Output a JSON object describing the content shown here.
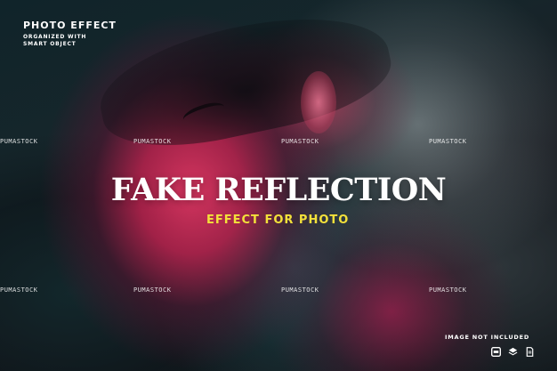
{
  "brand": {
    "title": "PHOTO EFFECT",
    "subtitle_line1": "ORGANIZED WITH",
    "subtitle_line2": "SMART OBJECT"
  },
  "watermarks": [
    "PUMASTOCK",
    "PUMASTOCK",
    "PUMASTOCK",
    "PUMASTOCK",
    "PUMASTOCK",
    "PUMASTOCK",
    "PUMASTOCK",
    "PUMASTOCK"
  ],
  "headline": {
    "main": "FAKE REFLECTION",
    "sub": "EFFECT FOR PHOTO"
  },
  "footer": {
    "note": "IMAGE NOT INCLUDED",
    "icons": [
      "photoshop-icon",
      "layers-icon",
      "document-icon"
    ]
  },
  "colors": {
    "headline": "#ffffff",
    "subheadline": "#f3e13a",
    "accent_pink": "#de3662",
    "accent_teal": "#285a5f"
  }
}
